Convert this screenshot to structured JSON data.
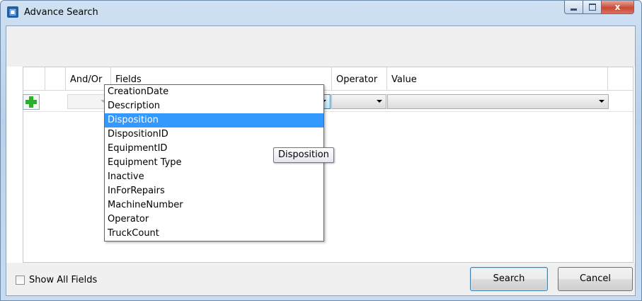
{
  "window": {
    "title": "Advance Search",
    "app_icon": "app-icon",
    "close_glyph": "x"
  },
  "grid": {
    "columns": [
      "And/Or",
      "Fields",
      "Operator",
      "Value"
    ]
  },
  "fields_dropdown": {
    "selected_index": 2,
    "options": [
      "CreationDate",
      "Description",
      "Disposition",
      "DispositionID",
      "EquipmentID",
      "Equipment Type",
      "Inactive",
      "InForRepairs",
      "MachineNumber",
      "Operator",
      "TruckCount"
    ]
  },
  "tooltip": "Disposition",
  "footer": {
    "show_all_fields_label": "Show All Fields",
    "show_all_fields_checked": false,
    "search_label": "Search",
    "cancel_label": "Cancel"
  },
  "colors": {
    "selection": "#3399ff",
    "add_icon": "#28b028"
  }
}
